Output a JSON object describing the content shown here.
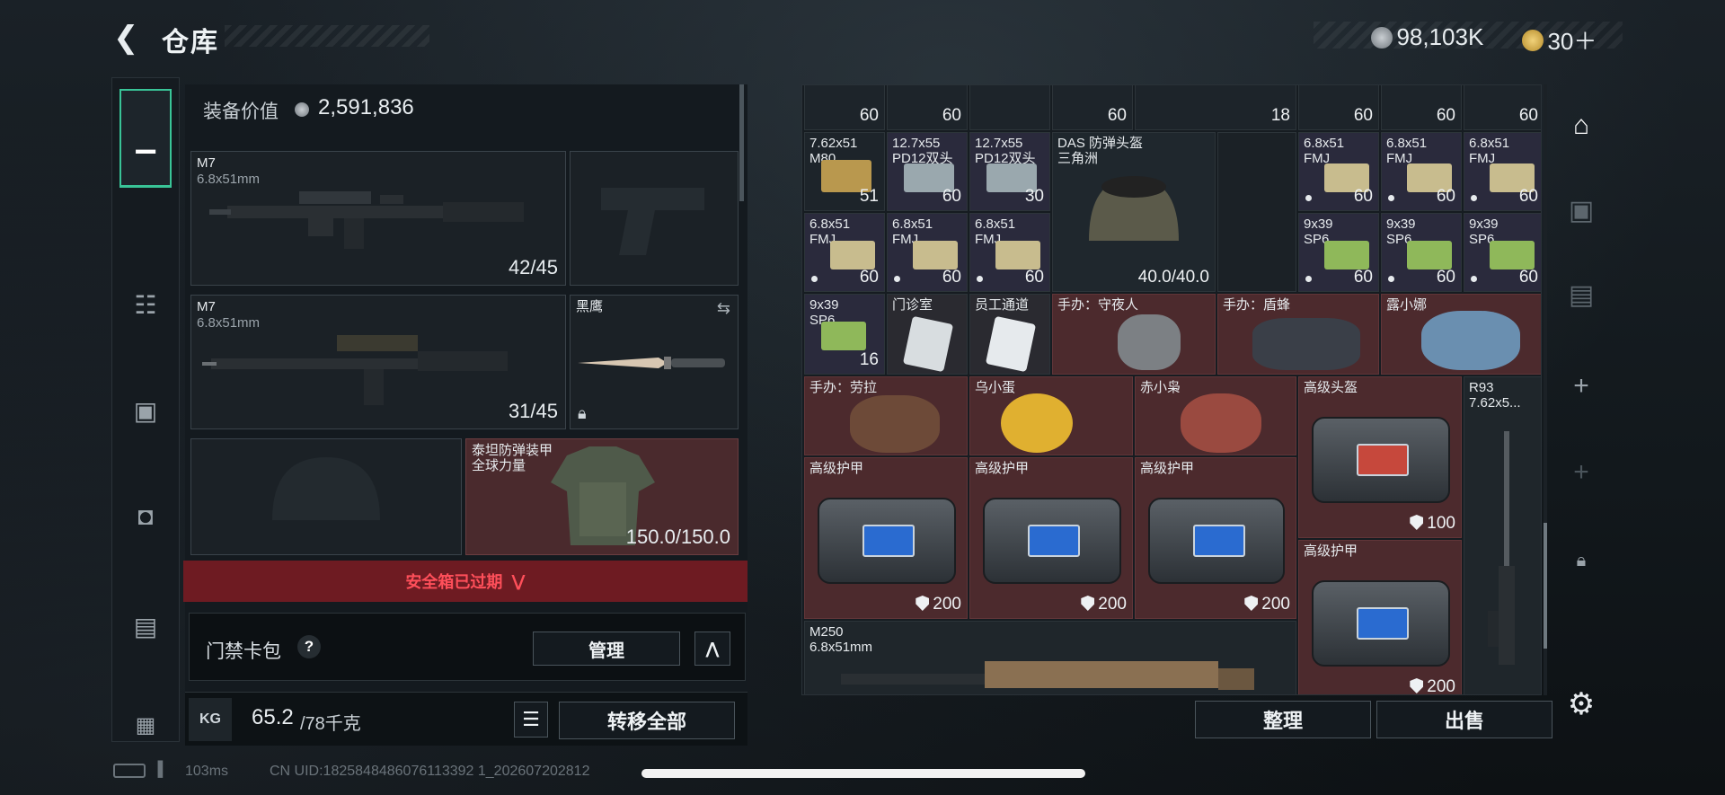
{
  "header": {
    "title": "仓库",
    "currency_1": "98,103K",
    "currency_2": "30＋"
  },
  "equipment": {
    "value_label": "装备价值",
    "value": "2,591,836",
    "slots": [
      {
        "name": "M7",
        "caliber": "6.8x51mm",
        "ammo": "42/45"
      },
      {
        "name": "M7",
        "caliber": "6.8x51mm",
        "ammo": "31/45"
      },
      {
        "name": "黑鹰"
      },
      {
        "name": "泰坦防弹装甲\n全球力量",
        "durability": "150.0/150.0"
      }
    ],
    "safebox_expired": "安全箱已过期",
    "keycard_label": "门禁卡包",
    "keycard_help": "?",
    "manage_label": "管理",
    "weight_value": "65.2",
    "weight_max": "/78千克",
    "transfer_all_label": "转移全部"
  },
  "inventory": {
    "top_row": [
      "60",
      "60",
      "60",
      "18",
      "60",
      "60",
      "60"
    ],
    "row2": [
      {
        "label": "7.62x51\nM80",
        "count": "51"
      },
      {
        "label": "12.7x55\nPD12双头",
        "count": "60"
      },
      {
        "label": "12.7x55\nPD12双头",
        "count": "30"
      },
      {
        "label": "DAS 防弹头盔\n三角洲",
        "count": "40.0/40.0"
      },
      {
        "label": "6.8x51\nFMJ",
        "count": "60"
      },
      {
        "label": "6.8x51\nFMJ",
        "count": "60"
      },
      {
        "label": "6.8x51\nFMJ",
        "count": "60"
      }
    ],
    "row3": [
      {
        "label": "6.8x51\nFMJ",
        "count": "60"
      },
      {
        "label": "6.8x51\nFMJ",
        "count": "60"
      },
      {
        "label": "6.8x51\nFMJ",
        "count": "60"
      },
      {
        "label": "9x39\nSP6",
        "count": "60"
      },
      {
        "label": "9x39\nSP6",
        "count": "60"
      },
      {
        "label": "9x39\nSP6",
        "count": "60"
      }
    ],
    "row4": [
      {
        "label": "9x39\nSP6",
        "count": "16"
      },
      {
        "label": "门诊室"
      },
      {
        "label": "员工通道"
      },
      {
        "label": "手办：守夜人"
      },
      {
        "label": "手办：盾蜂"
      },
      {
        "label": "露小娜"
      }
    ],
    "row5": [
      {
        "label": "手办：劳拉"
      },
      {
        "label": "乌小蛋"
      },
      {
        "label": "赤小枭"
      },
      {
        "label": "高级头盔",
        "count": "100"
      },
      {
        "label": "R93\n7.62x5..."
      }
    ],
    "row6": [
      {
        "label": "高级护甲",
        "count": "200"
      },
      {
        "label": "高级护甲",
        "count": "200"
      },
      {
        "label": "高级护甲",
        "count": "200"
      },
      {
        "label": "高级护甲",
        "count": "200"
      }
    ],
    "row7": [
      {
        "label": "M250\n6.8x51mm"
      }
    ],
    "sort_label": "整理",
    "sell_label": "出售"
  },
  "status": {
    "ping": "103ms",
    "uid": "CN UID:1825848486076113392 1_202607202812"
  }
}
